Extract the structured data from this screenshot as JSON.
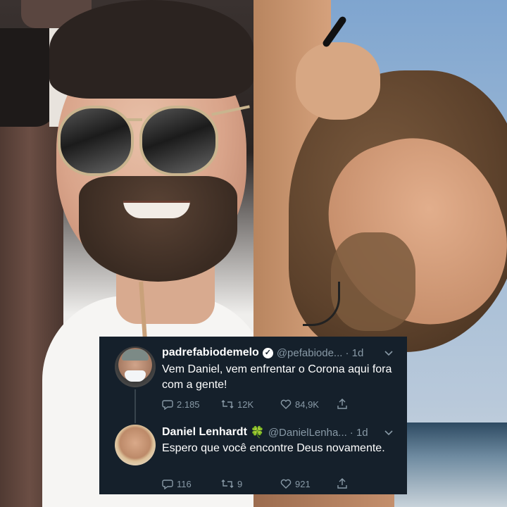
{
  "tweets": [
    {
      "name": "padrefabiodemelo",
      "verified": true,
      "handle": "@pefabiode...",
      "time": "· 1d",
      "text": "Vem Daniel, vem enfrentar o Corona aqui fora com a gente!",
      "reply_count": "2.185",
      "retweet_count": "12K",
      "like_count": "84,9K"
    },
    {
      "name": "Daniel Lenhardt",
      "emoji": "🍀",
      "handle": "@DanielLenha...",
      "time": "· 1d",
      "text": "Espero que você encontre Deus novamente.",
      "reply_count": "116",
      "retweet_count": "9",
      "like_count": "921"
    }
  ],
  "icons": {
    "verified": "verified-badge-icon",
    "chevron": "chevron-down-icon",
    "reply": "reply-icon",
    "retweet": "retweet-icon",
    "like": "like-icon",
    "share": "share-icon"
  },
  "colors": {
    "card_bg": "#15202b",
    "secondary_text": "#8899a6",
    "primary_text": "#ffffff"
  }
}
